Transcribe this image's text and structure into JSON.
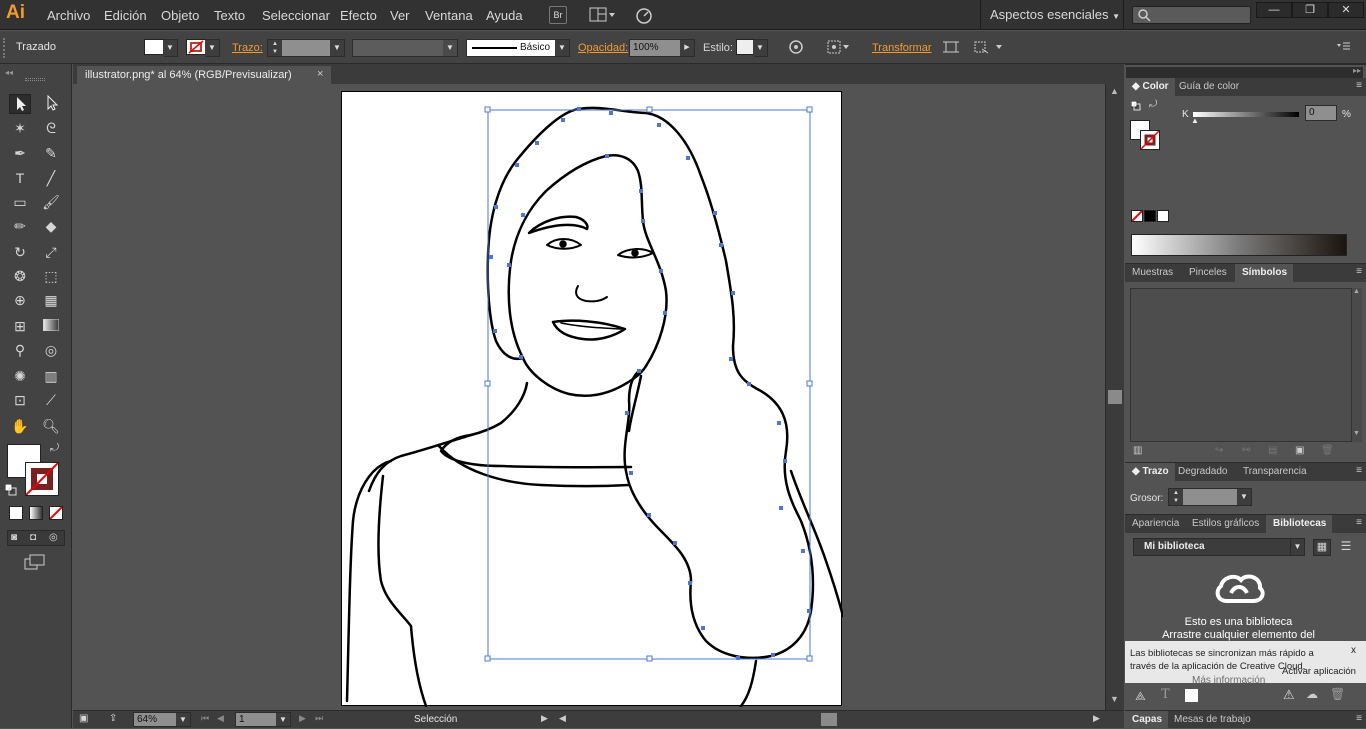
{
  "app": {
    "logo": "Ai"
  },
  "menu": [
    "Archivo",
    "Edición",
    "Objeto",
    "Texto",
    "Seleccionar",
    "Efecto",
    "Ver",
    "Ventana",
    "Ayuda"
  ],
  "menubar": {
    "br_label": "Br",
    "workspace": "Aspectos esenciales",
    "window_buttons": [
      "—",
      "❐",
      "✕"
    ]
  },
  "control": {
    "selection_label": "Trazado",
    "stroke_label": "Trazo:",
    "brush_label": "Básico",
    "opacity_label": "Opacidad:",
    "opacity_value": "100%",
    "style_label": "Estilo:",
    "transform_label": "Transformar"
  },
  "document": {
    "tab_title": "illustrator.png* al 64% (RGB/Previsualizar)",
    "close": "×"
  },
  "status": {
    "zoom": "64%",
    "page": "1",
    "tool": "Selección"
  },
  "panels": {
    "color": {
      "tabs": [
        "Color",
        "Guía de color"
      ],
      "channel": "K",
      "value": "0",
      "unit": "%"
    },
    "symbols": {
      "tabs": [
        "Muestras",
        "Pinceles",
        "Símbolos"
      ]
    },
    "stroke": {
      "tabs": [
        "Trazo",
        "Degradado",
        "Transparencia"
      ],
      "weight_label": "Grosor:"
    },
    "libraries": {
      "tabs": [
        "Apariencia",
        "Estilos gráficos",
        "Bibliotecas"
      ],
      "library_name": "Mi biblioteca",
      "empty_title": "Esto es una biblioteca",
      "empty_line": "Arrastre cualquier elemento del",
      "notice": "Las bibliotecas se sincronizan más rápido a través de la aplicación de Creative Cloud.",
      "notice_close": "x",
      "activate": "Activar aplicación",
      "hidden_text": "Más información"
    },
    "bottom_tabs": [
      "Capas",
      "Mesas de trabajo"
    ]
  },
  "colors": {
    "accent": "#f39a2e",
    "selection": "#4a78d8",
    "chrome_dark": "#323232",
    "chrome": "#434343",
    "canvas": "#535353"
  }
}
